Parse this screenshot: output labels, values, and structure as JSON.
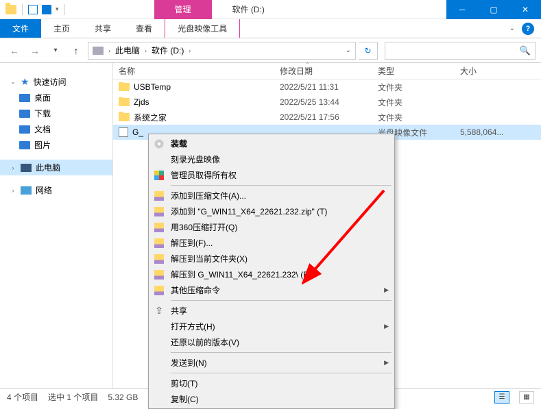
{
  "titlebar": {
    "context_tab": "管理",
    "title": "软件 (D:)"
  },
  "ribbon": {
    "file": "文件",
    "tabs": [
      "主页",
      "共享",
      "查看",
      "光盘映像工具"
    ]
  },
  "breadcrumb": {
    "items": [
      "此电脑",
      "软件 (D:)"
    ]
  },
  "columns": {
    "name": "名称",
    "date": "修改日期",
    "type": "类型",
    "size": "大小"
  },
  "rows": [
    {
      "name": "USBTemp",
      "date": "2022/5/21 11:31",
      "type": "文件夹",
      "size": "",
      "kind": "folder"
    },
    {
      "name": "Zjds",
      "date": "2022/5/25 13:44",
      "type": "文件夹",
      "size": "",
      "kind": "folder"
    },
    {
      "name": "系统之家",
      "date": "2022/5/21 17:56",
      "type": "文件夹",
      "size": "",
      "kind": "folder"
    },
    {
      "name": "G_",
      "date": "",
      "type": "光盘映像文件",
      "size": "5,588,064...",
      "kind": "iso",
      "selected": true
    }
  ],
  "sidebar": {
    "quick": "快速访问",
    "desktop": "桌面",
    "downloads": "下载",
    "documents": "文档",
    "pictures": "图片",
    "thispc": "此电脑",
    "network": "网络"
  },
  "context_menu": {
    "items": [
      {
        "label": "装载",
        "icon": "disc",
        "bold": true
      },
      {
        "label": "刻录光盘映像",
        "icon": ""
      },
      {
        "label": "管理员取得所有权",
        "icon": "shield"
      },
      {
        "sep": true
      },
      {
        "label": "添加到压缩文件(A)...",
        "icon": "zip"
      },
      {
        "label": "添加到 \"G_WIN11_X64_22621.232.zip\" (T)",
        "icon": "zip"
      },
      {
        "label": "用360压缩打开(Q)",
        "icon": "zip"
      },
      {
        "label": "解压到(F)...",
        "icon": "zip"
      },
      {
        "label": "解压到当前文件夹(X)",
        "icon": "zip"
      },
      {
        "label": "解压到 G_WIN11_X64_22621.232\\ (E)",
        "icon": "zip"
      },
      {
        "label": "其他压缩命令",
        "icon": "zip",
        "submenu": true
      },
      {
        "sep": true
      },
      {
        "label": "共享",
        "icon": "share"
      },
      {
        "label": "打开方式(H)",
        "icon": "",
        "submenu": true
      },
      {
        "label": "还原以前的版本(V)",
        "icon": ""
      },
      {
        "sep": true
      },
      {
        "label": "发送到(N)",
        "icon": "",
        "submenu": true
      },
      {
        "sep": true
      },
      {
        "label": "剪切(T)",
        "icon": ""
      },
      {
        "label": "复制(C)",
        "icon": ""
      }
    ]
  },
  "statusbar": {
    "count": "4 个项目",
    "selection": "选中 1 个项目",
    "size": "5.32 GB"
  }
}
